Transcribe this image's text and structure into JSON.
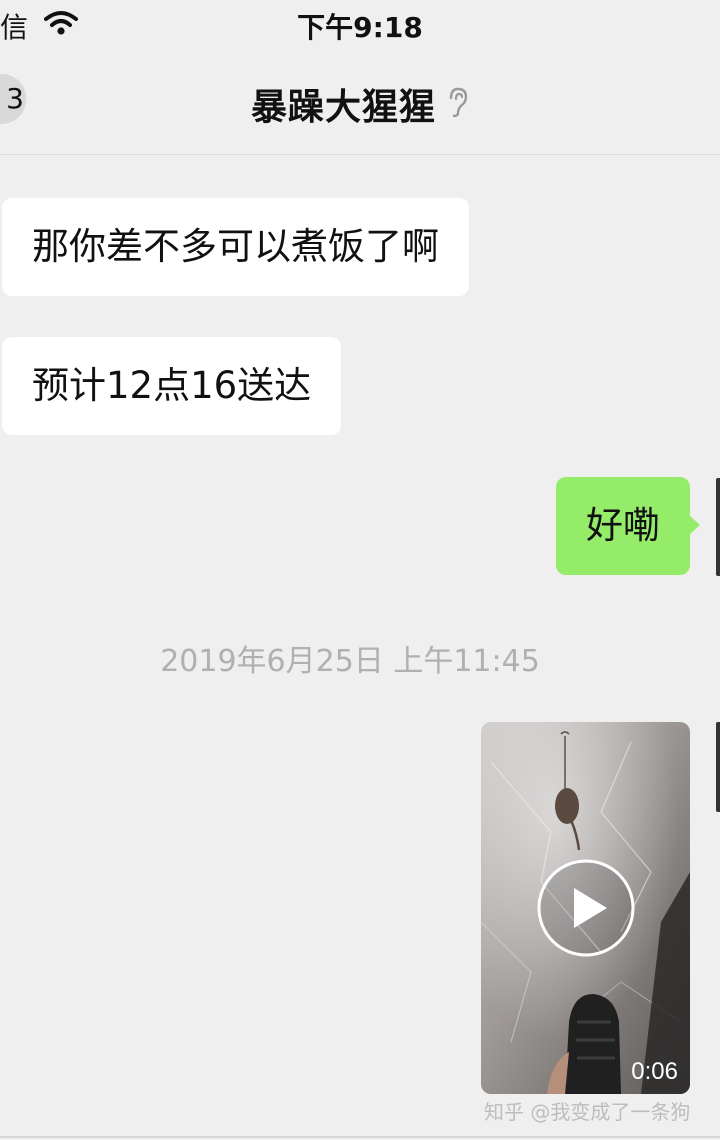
{
  "status_bar": {
    "carrier": "信",
    "time": "下午9:18"
  },
  "nav": {
    "back_badge": "3",
    "title": "暴躁大猩猩"
  },
  "messages": [
    {
      "side": "in",
      "text": "那你差不多可以煮饭了啊"
    },
    {
      "side": "in",
      "text": "预计12点16送达"
    },
    {
      "side": "out",
      "text": "好嘞"
    }
  ],
  "timestamp": "2019年6月25日 上午11:45",
  "video": {
    "duration": "0:06"
  },
  "watermark": "知乎 @我变成了一条狗",
  "colors": {
    "background": "#efefef",
    "incoming": "#ffffff",
    "outgoing": "#95ec69",
    "timestamp": "#b0b0b0"
  },
  "icons": [
    "wifi-icon",
    "ear-icon",
    "play-icon"
  ]
}
